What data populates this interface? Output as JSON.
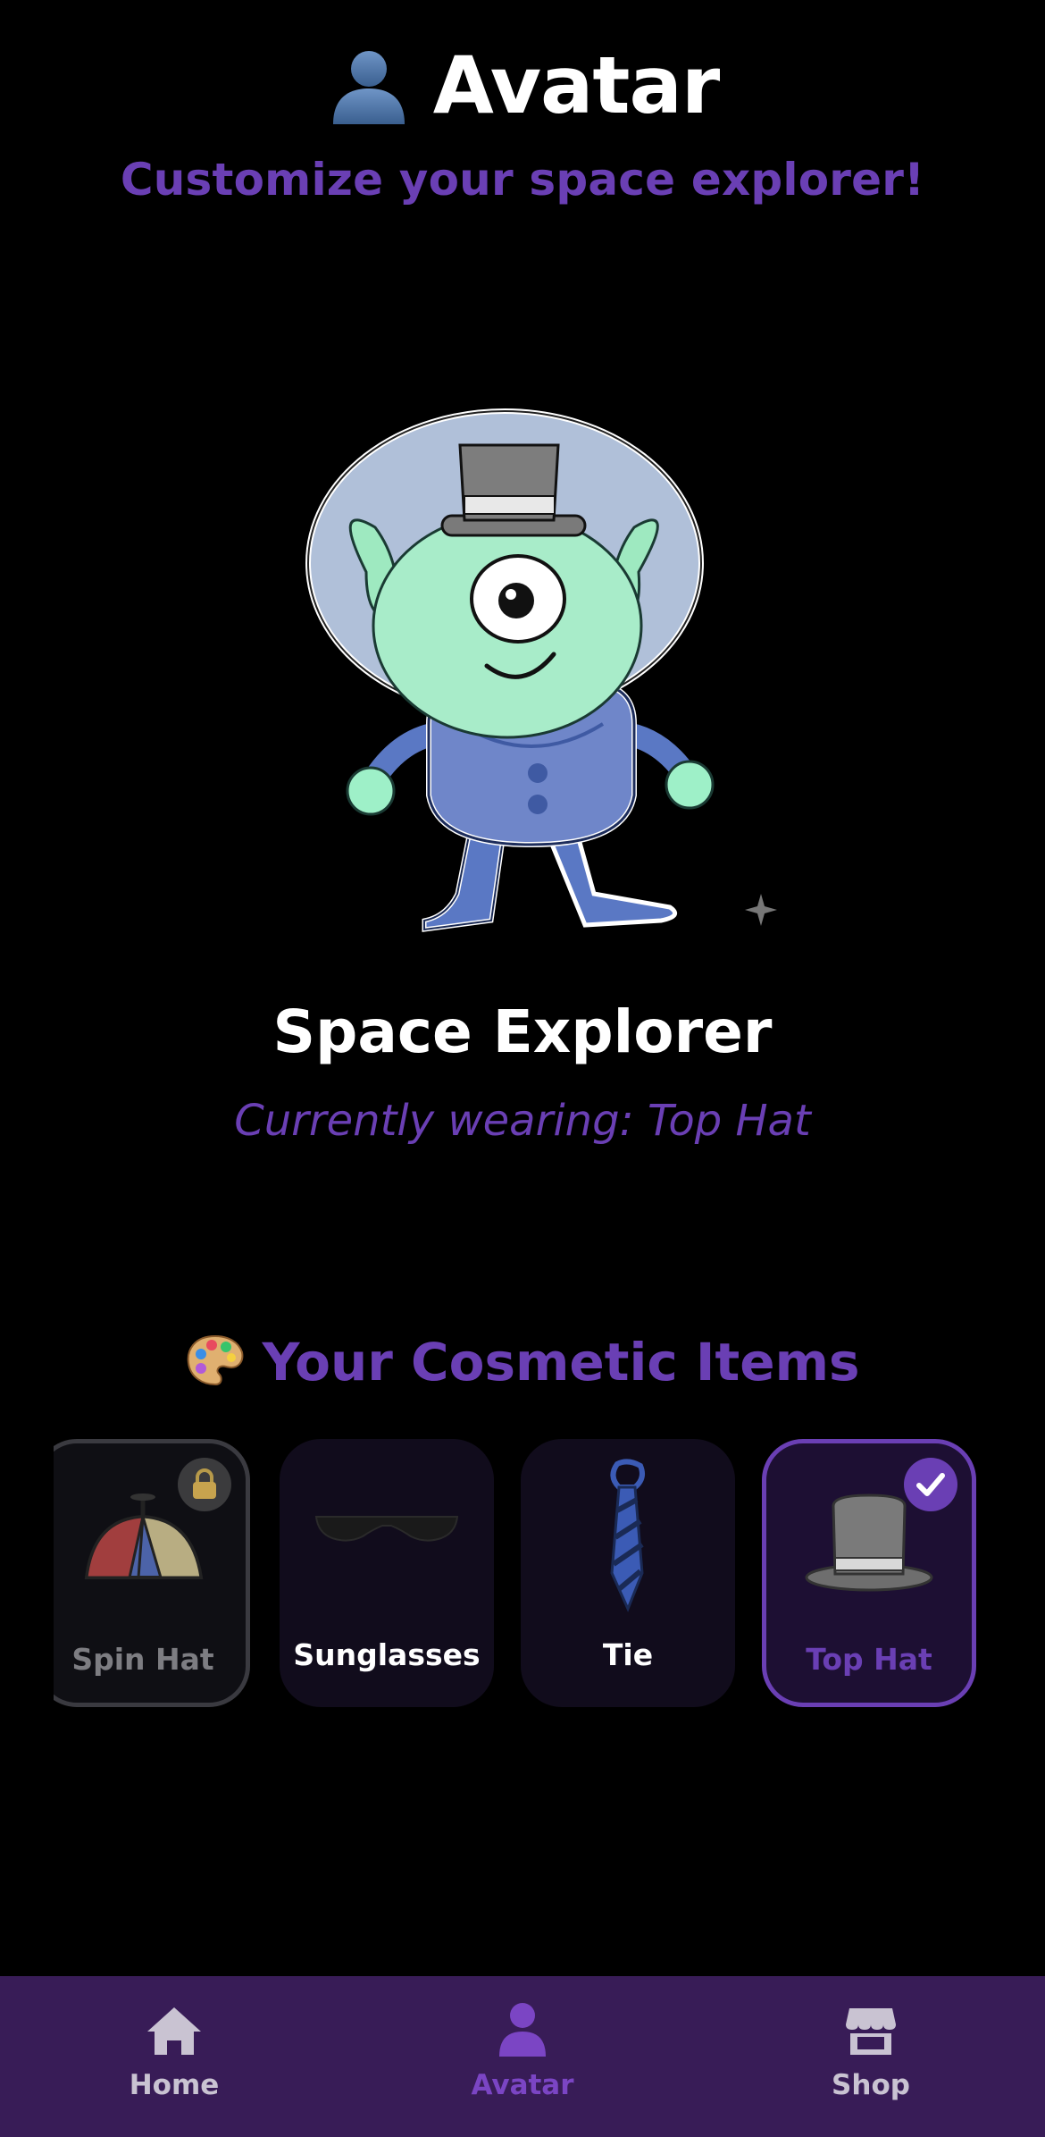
{
  "header": {
    "title": "Avatar",
    "title_icon": "person-silhouette-icon",
    "subtitle": "Customize your space explorer!"
  },
  "avatar": {
    "name": "Space Explorer",
    "wearing_text": "Currently wearing: Top Hat",
    "character": "alien-in-helmet-with-top-hat"
  },
  "items_section": {
    "title": "Your Cosmetic Items",
    "title_icon": "palette-icon",
    "items": [
      {
        "label": "Spin Hat",
        "icon": "propeller-cap-icon",
        "state": "locked"
      },
      {
        "label": "Sunglasses",
        "icon": "sunglasses-icon",
        "state": "owned"
      },
      {
        "label": "Tie",
        "icon": "tie-icon",
        "state": "owned"
      },
      {
        "label": "Top Hat",
        "icon": "top-hat-icon",
        "state": "equipped"
      }
    ]
  },
  "tab_bar": {
    "tabs": [
      {
        "label": "Home",
        "icon": "house-icon",
        "active": false
      },
      {
        "label": "Avatar",
        "icon": "person-icon",
        "active": true
      },
      {
        "label": "Shop",
        "icon": "storefront-icon",
        "active": false
      }
    ]
  },
  "colors": {
    "background": "#000000",
    "accent_purple": "#6a3fb4",
    "tab_bar": "#381c57",
    "card": "#110c1c"
  }
}
